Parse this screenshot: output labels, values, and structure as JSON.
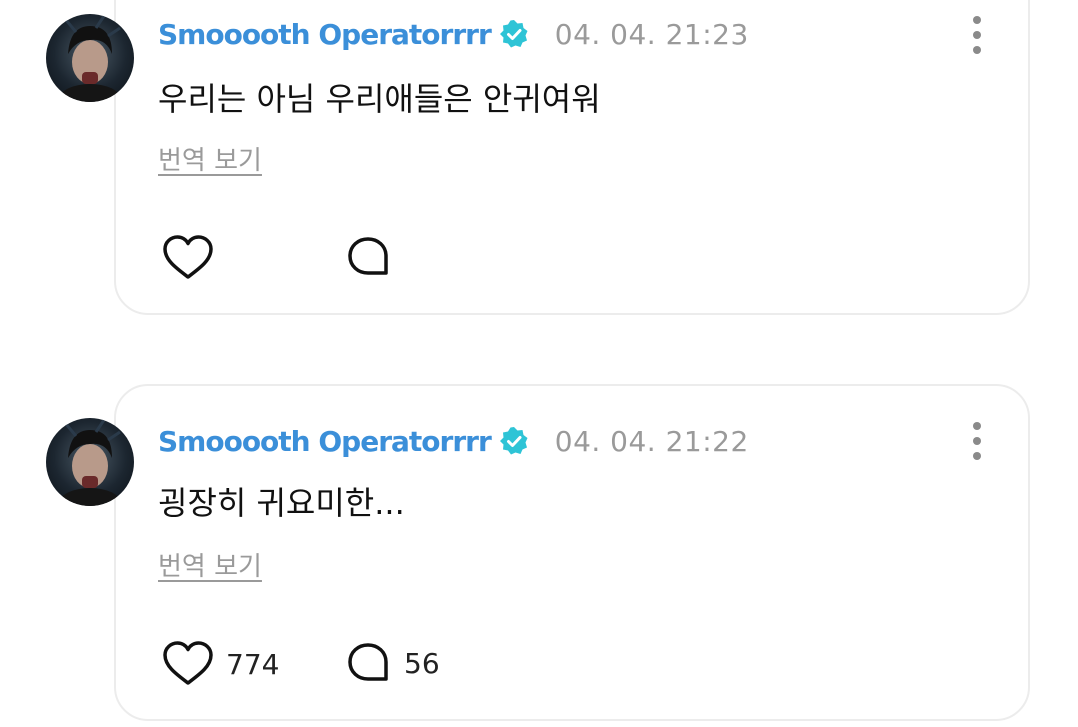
{
  "posts": [
    {
      "username": "Smooooth Operatorrrr",
      "timestamp": "04. 04. 21:23",
      "text": "우리는 아님 우리애들은 안귀여워",
      "translate_label": "번역 보기",
      "likes": "",
      "comments": ""
    },
    {
      "username": "Smooooth Operatorrrr",
      "timestamp": "04. 04. 21:22",
      "text": "굉장히 귀요미한...",
      "translate_label": "번역 보기",
      "likes": "774",
      "comments": "56"
    }
  ],
  "colors": {
    "username": "#3b8fd9",
    "verified": "#2ec4d6",
    "timestamp": "#9a9a9a",
    "border": "#ececec"
  },
  "icons": {
    "verified": "verified-badge-icon",
    "more": "more-vertical-icon",
    "like": "heart-icon",
    "comment": "comment-bubble-icon"
  }
}
